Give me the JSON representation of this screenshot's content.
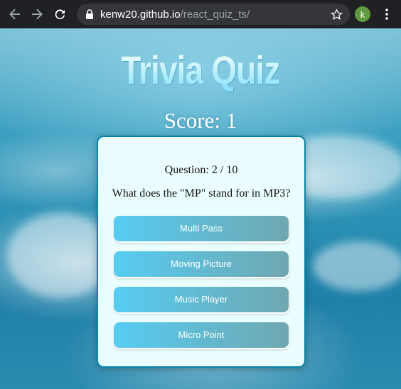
{
  "browser": {
    "url_host": "kenw20.github.io",
    "url_path": "/react_quiz_ts/",
    "profile_initial": "k",
    "icons": [
      "back-arrow-icon",
      "forward-arrow-icon",
      "reload-icon",
      "lock-icon",
      "star-icon",
      "kebab-menu-icon"
    ]
  },
  "page": {
    "title": "Trivia Quiz",
    "score_text": "Score: 1",
    "question_number": "Question: 2 / 10",
    "question_text": "What does the \"MP\" stand for in MP3?",
    "answers": [
      "Multi Pass",
      "Moving Picture",
      "Music Player",
      "Micro Point"
    ]
  },
  "colors": {
    "card_border": "#0b85a5",
    "card_background": "#ebfeff",
    "button_gradient_start": "#56ccf2",
    "button_gradient_end": "#6fa7b0",
    "avatar": "#5f9b3c"
  }
}
